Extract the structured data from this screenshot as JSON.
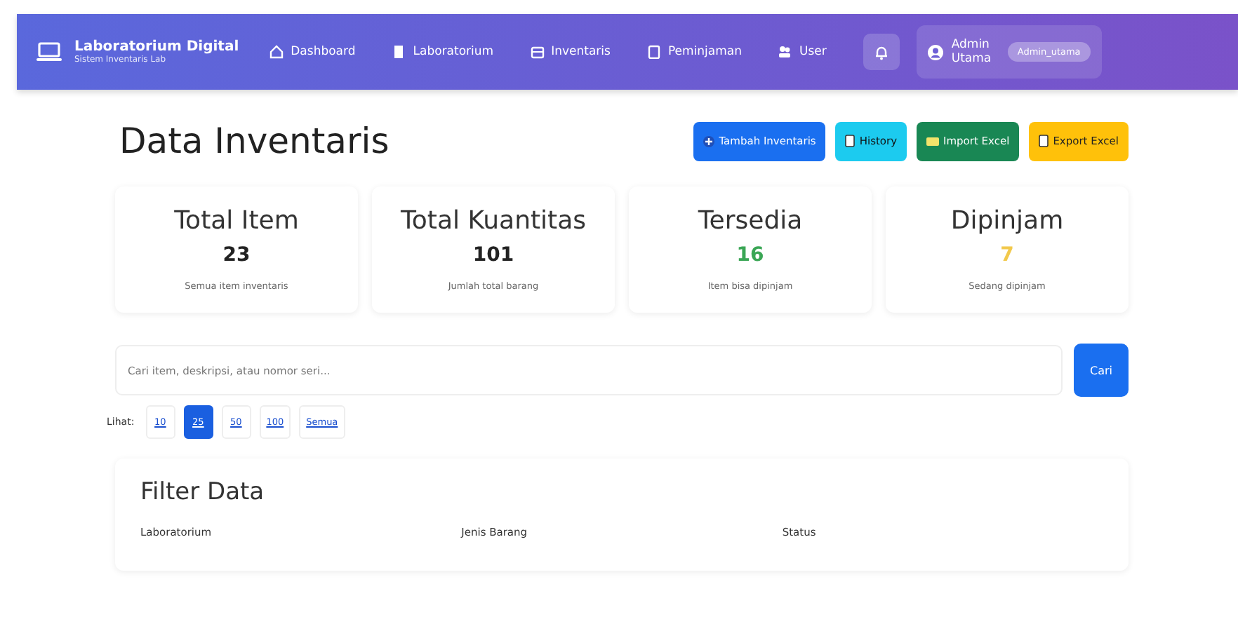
{
  "brand": {
    "title": "Laboratorium Digital",
    "subtitle": "Sistem Inventaris Lab"
  },
  "nav": [
    "Dashboard",
    "Laboratorium",
    "Inventaris",
    "Peminjaman",
    "User"
  ],
  "user": {
    "name": "Admin Utama",
    "role": "Admin_utama"
  },
  "page_title": "Data Inventaris",
  "actions": [
    {
      "label": "Tambah Inventaris",
      "kind": "primary"
    },
    {
      "label": "History",
      "kind": "info"
    },
    {
      "label": "Import Excel",
      "kind": "success"
    },
    {
      "label": "Export Excel",
      "kind": "warning"
    }
  ],
  "stats": [
    {
      "title": "Total Item",
      "value": "23",
      "note": "Semua item inventaris",
      "color": "#222222"
    },
    {
      "title": "Total Kuantitas",
      "value": "101",
      "note": "Jumlah total barang",
      "color": "#222222"
    },
    {
      "title": "Tersedia",
      "value": "16",
      "note": "Item bisa dipinjam",
      "color": "#3aa655"
    },
    {
      "title": "Dipinjam",
      "value": "7",
      "note": "Sedang dipinjam",
      "color": "#f2c94c"
    }
  ],
  "search": {
    "placeholder": "Cari item, deskripsi, atau nomor seri...",
    "button": "Cari"
  },
  "per_page": {
    "label": "Lihat:",
    "options": [
      {
        "label": "10",
        "selected": false
      },
      {
        "label": "25",
        "selected": true
      },
      {
        "label": "50",
        "selected": false
      },
      {
        "label": "100",
        "selected": false
      },
      {
        "label": "Semua",
        "selected": false
      }
    ]
  },
  "filter": {
    "title": "Filter Data",
    "fields": [
      "Laboratorium",
      "Jenis Barang",
      "Status"
    ]
  }
}
